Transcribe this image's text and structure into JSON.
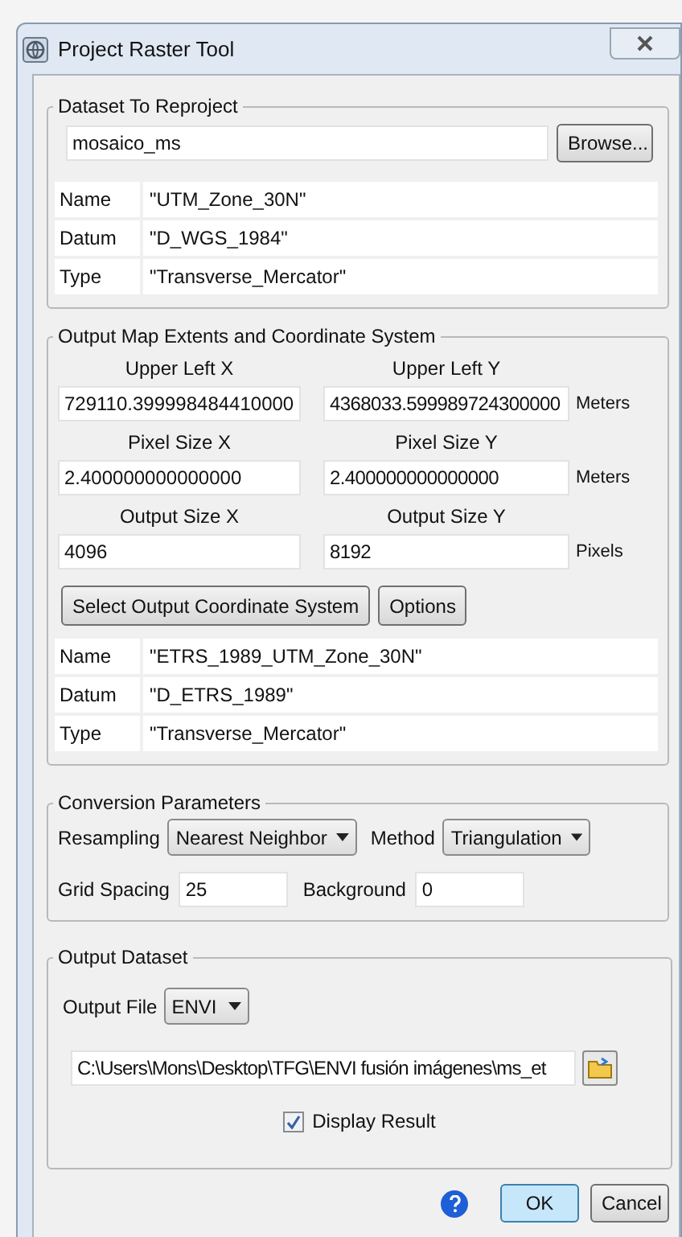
{
  "window": {
    "title": "Project Raster Tool"
  },
  "dataset_group": {
    "title": "Dataset To Reproject",
    "dataset_field": {
      "value": "mosaico_ms"
    },
    "browse_button": "Browse...",
    "properties": [
      {
        "label": "Name",
        "value": "\"UTM_Zone_30N\""
      },
      {
        "label": "Datum",
        "value": "\"D_WGS_1984\""
      },
      {
        "label": "Type",
        "value": "\"Transverse_Mercator\""
      }
    ]
  },
  "output_group": {
    "title": "Output Map Extents and Coordinate System",
    "rows": [
      {
        "x_label": "Upper Left X",
        "x_value": "729110.399998484410000",
        "y_label": "Upper Left Y",
        "y_value": "4368033.599989724300000",
        "unit": "Meters"
      },
      {
        "x_label": "Pixel Size X",
        "x_value": "2.400000000000000",
        "y_label": "Pixel Size Y",
        "y_value": "2.400000000000000",
        "unit": "Meters"
      },
      {
        "x_label": "Output Size X",
        "x_value": "4096",
        "y_label": "Output Size Y",
        "y_value": "8192",
        "unit": "Pixels"
      }
    ],
    "buttons": [
      "Select Output Coordinate System",
      "Options"
    ],
    "properties": [
      {
        "label": "Name",
        "value": "\"ETRS_1989_UTM_Zone_30N\""
      },
      {
        "label": "Datum",
        "value": "\"D_ETRS_1989\""
      },
      {
        "label": "Type",
        "value": "\"Transverse_Mercator\""
      }
    ]
  },
  "conversion_group": {
    "title": "Conversion Parameters",
    "resampling": {
      "label": "Resampling",
      "value": "Nearest Neighbor"
    },
    "method": {
      "label": "Method",
      "value": "Triangulation"
    },
    "grid_spacing": {
      "label": "Grid Spacing",
      "value": "25"
    },
    "background": {
      "label": "Background",
      "value": "0"
    }
  },
  "output_dataset_group": {
    "title": "Output Dataset",
    "output_file": {
      "label": "Output File",
      "value": "ENVI"
    },
    "path_field": {
      "value": "C:\\Users\\Mons\\Desktop\\TFG\\ENVI fusión imágenes\\ms_et"
    },
    "display_result": {
      "label": "Display Result",
      "checked": true
    }
  },
  "footer_buttons": [
    {
      "label": "OK",
      "default": true
    },
    {
      "label": "Cancel",
      "default": false
    }
  ]
}
